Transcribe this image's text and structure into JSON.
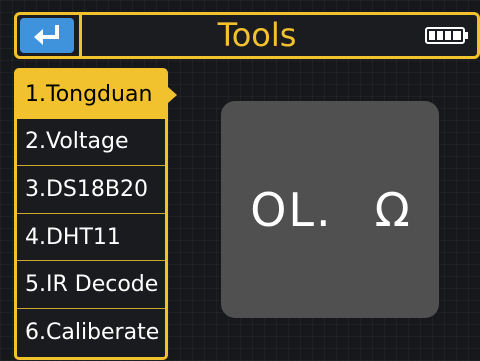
{
  "header": {
    "title": "Tools",
    "back_icon": "return-arrow-icon",
    "battery_icon": "battery-full-icon",
    "accent_color": "#f2c12e",
    "back_button_color": "#3f93dd"
  },
  "menu": {
    "selected_index": 0,
    "items": [
      {
        "label": "1.Tongduan"
      },
      {
        "label": "2.Voltage"
      },
      {
        "label": "3.DS18B20"
      },
      {
        "label": "4.DHT11"
      },
      {
        "label": "5.IR Decode"
      },
      {
        "label": "6.Caliberate"
      }
    ]
  },
  "display": {
    "value": "OL.",
    "unit": "Ω"
  }
}
